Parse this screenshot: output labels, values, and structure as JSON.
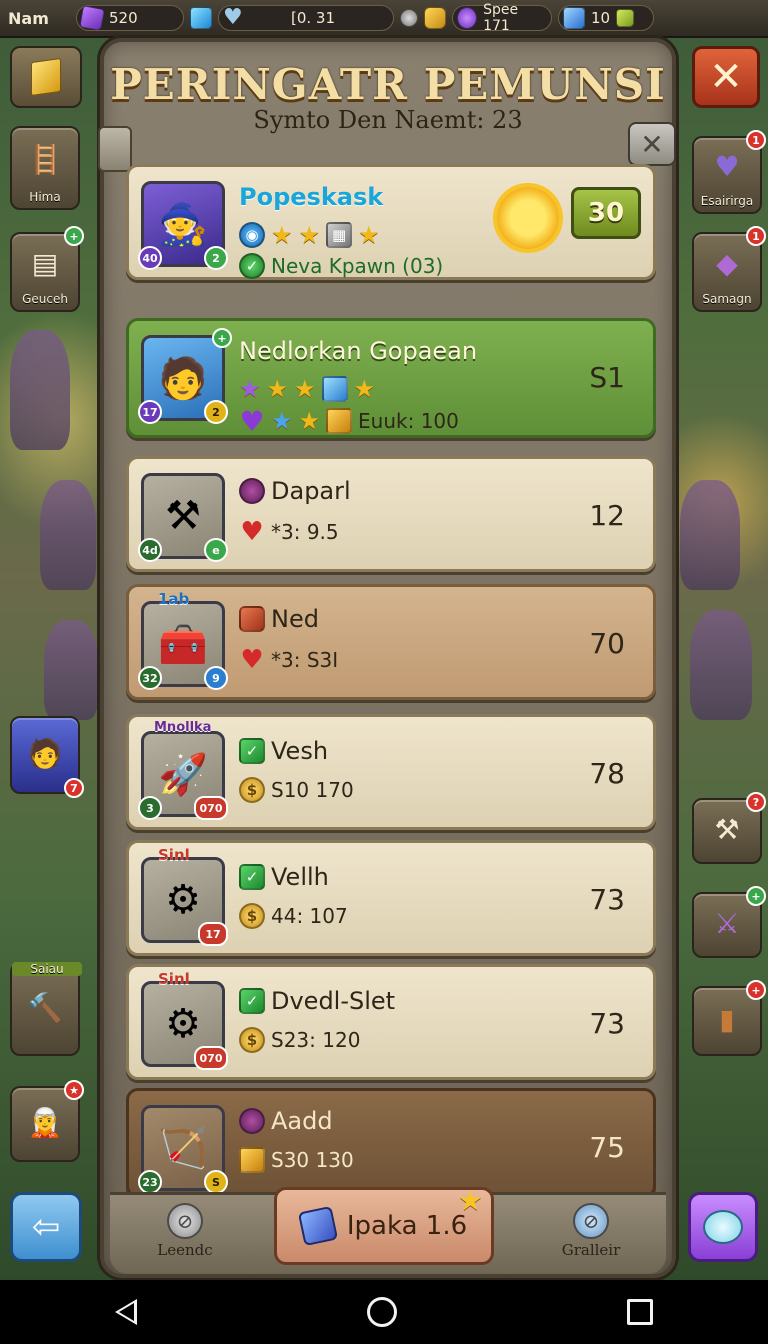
{
  "topbar": {
    "name": "Nam",
    "resources": [
      {
        "icon": "purple-gem-icon",
        "value": "520"
      },
      {
        "icon": "blue-cube-icon",
        "value": ""
      },
      {
        "icon": "heart-icon",
        "value": "[0. 31"
      },
      {
        "icon": "settings-icon",
        "value": ""
      },
      {
        "icon": "purple-orb-icon",
        "value": "Spee 171"
      },
      {
        "icon": "bolt-icon",
        "value": "10"
      }
    ]
  },
  "title": "PERINGATR PEMUNSI",
  "subtitle": "Symto Den Naemt: 23",
  "left_sidebar": [
    {
      "label": "Hima",
      "icon": "ladder-icon"
    },
    {
      "label": "Geuceh",
      "icon": "chest-icon"
    },
    {
      "label": "",
      "icon": "hero-portrait-icon",
      "badge": "7"
    },
    {
      "label": "Saiau",
      "icon": "axe-icon"
    },
    {
      "label": "",
      "icon": "elf-portrait-icon"
    }
  ],
  "right_sidebar": [
    {
      "label": "Esairirga",
      "icon": "heart-gem-icon",
      "badge": "1"
    },
    {
      "label": "Samagn",
      "icon": "crystal-icon",
      "badge": "1"
    },
    {
      "label": "",
      "icon": "cannon-icon"
    },
    {
      "label": "",
      "icon": "sword-gem-icon"
    },
    {
      "label": "",
      "icon": "barrel-icon"
    }
  ],
  "cards": [
    {
      "name": "Popeskask",
      "style": "plain",
      "portrait": "hero1",
      "lvl_left": "40",
      "lvl_right": "2",
      "line1": "",
      "line2": "Neva Kpawn (03)",
      "value": "30"
    },
    {
      "name": "Nedlorkan Gopaean",
      "style": "green",
      "portrait": "hero2",
      "lvl_left": "17",
      "lvl_right": "2",
      "line1": "",
      "line2": "Euuk: 100",
      "value": "S1"
    },
    {
      "name": "Daparl",
      "style": "plain",
      "portrait": "item",
      "lvl_left": "4d",
      "lvl_right": "e",
      "line1": "",
      "line2": "*3: 9.5",
      "value": "12"
    },
    {
      "name": "Ned",
      "style": "tan",
      "portrait": "item",
      "tag": "1ab",
      "lvl_left": "32",
      "lvl_right": "9",
      "line1": "",
      "line2": "*3: S3I",
      "value": "70"
    },
    {
      "name": "Vesh",
      "style": "plain",
      "portrait": "item",
      "tag": "Mnollka",
      "lvl_left": "3",
      "lvl_right": "070",
      "line1": "S10  170",
      "line2": "",
      "value": "78"
    },
    {
      "name": "Vellh",
      "style": "plain",
      "portrait": "item",
      "tag": "Sinl",
      "lvl_left": "",
      "lvl_right": "17",
      "line1": "44:  107",
      "line2": "",
      "value": "73"
    },
    {
      "name": "Dvedl-Slet",
      "style": "plain",
      "portrait": "item",
      "tag": "Sinl",
      "lvl_left": "",
      "lvl_right": "070",
      "line1": "S23:  120",
      "line2": "",
      "value": "73"
    },
    {
      "name": "Aadd",
      "style": "brown",
      "portrait": "item",
      "lvl_left": "23",
      "lvl_right": "S",
      "line1": "S30  130",
      "line2": "",
      "value": "75"
    }
  ],
  "bottom": {
    "left_label": "Leendc",
    "buy_label": "Ipaka 1.6",
    "right_label": "Gralleir"
  }
}
